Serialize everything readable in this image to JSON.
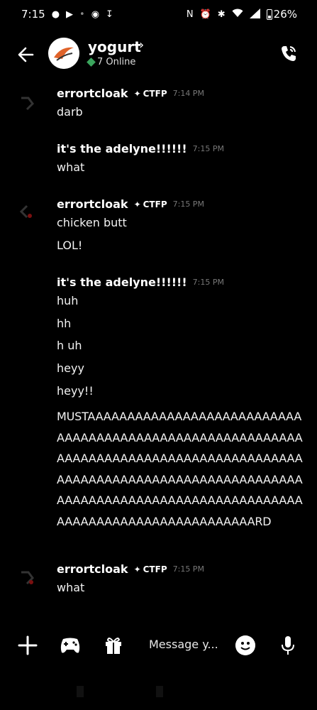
{
  "status_bar": {
    "time": "7:15",
    "battery": "26%",
    "battery_level": 0.26
  },
  "header": {
    "channel_name": "yogurt",
    "online_count": "7 Online"
  },
  "messages": [
    {
      "author": "errortcloak",
      "tag": "CTFP",
      "time": "7:14 PM",
      "lines": [
        "darb"
      ]
    },
    {
      "author": "it's the adelyne!!!!!!",
      "time": "7:15 PM",
      "lines": [
        "what"
      ]
    },
    {
      "author": "errortcloak",
      "tag": "CTFP",
      "time": "7:15 PM",
      "lines": [
        "chicken butt",
        "LOL!"
      ]
    },
    {
      "author": "it's the adelyne!!!!!!",
      "time": "7:15 PM",
      "lines": [
        "huh",
        "hh",
        "h uh",
        "heyy",
        "heyy!!"
      ],
      "long_text": "MUSTAAAAAAAAAAAAAAAAAAAAAAAAAAAAAAAAAAAAAAAAAAAAAAAAAAAAAAAAAAAAAAAAAAAAAAAAAAAAAAAAAAAAAAAAAAAAAAAAAAAAAAAAAAAAAAAAAAAAAAAAAAAAAAAAAAAAAAAAAAAAAAAAAAAAAAAAAAAAAAAAAAAAAAAAAAAAAAAARD"
    },
    {
      "author": "errortcloak",
      "tag": "CTFP",
      "time": "7:15 PM",
      "lines": [
        "what"
      ]
    }
  ],
  "composer": {
    "placeholder": "Message y..."
  },
  "colors": {
    "background": "#000000",
    "online": "#3ba55d",
    "timestamp": "#777777"
  },
  "icons": [
    "back-arrow-icon",
    "call-icon",
    "plus-icon",
    "gamepad-icon",
    "gift-icon",
    "emoji-icon",
    "mic-icon"
  ]
}
